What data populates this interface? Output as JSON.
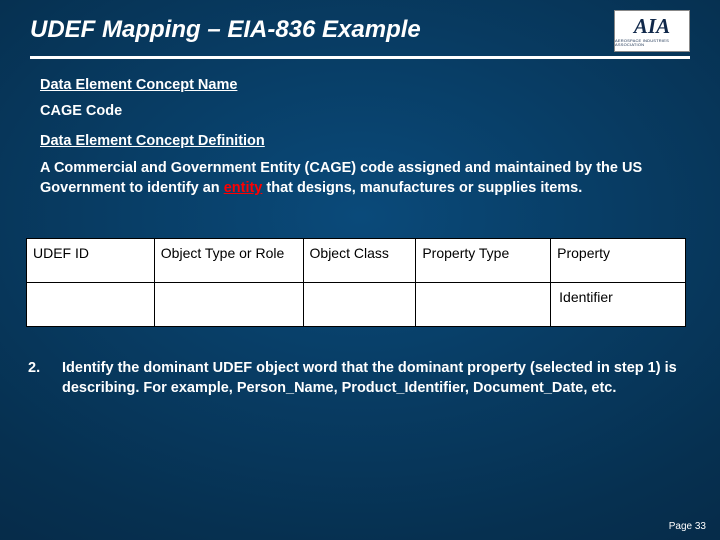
{
  "title": "UDEF Mapping – EIA-836 Example",
  "logo": {
    "main": "AIA",
    "sub": "AEROSPACE INDUSTRIES ASSOCIATION"
  },
  "labels": {
    "concept_name": "Data Element Concept Name",
    "concept_def": "Data Element Concept Definition"
  },
  "values": {
    "cage_code": "CAGE Code"
  },
  "definition": {
    "pre": "A Commercial and Government Entity (CAGE) code assigned and maintained by the US Government to identify an ",
    "hl": "entity",
    "post": " that designs, manufactures or supplies items."
  },
  "table": {
    "headers": [
      "UDEF ID",
      "Object Type or Role",
      "Object Class",
      "Property Type",
      "Property"
    ],
    "row": [
      "",
      "",
      "",
      "",
      "Identifier"
    ]
  },
  "step": {
    "num": "2.",
    "text": "Identify the dominant UDEF object word that the dominant property (selected in step 1) is describing. For example, Person_Name, Product_Identifier, Document_Date, etc."
  },
  "page": "Page 33"
}
